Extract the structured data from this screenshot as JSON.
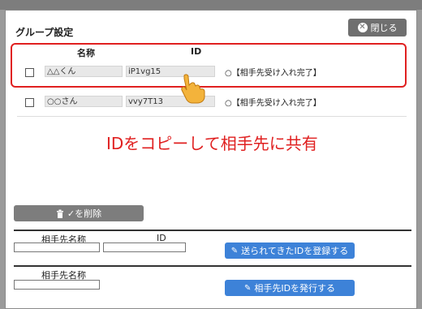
{
  "background": {
    "label1": "",
    "label2": ""
  },
  "dialog": {
    "title": "グループ設定",
    "close_label": "閉じる"
  },
  "table": {
    "headers": {
      "name": "名称",
      "id": "ID"
    },
    "rows": [
      {
        "name": "△△くん",
        "id": "iP1vg15",
        "status": "○【相手先受け入れ完了】"
      },
      {
        "name": "○○さん",
        "id": "vvy7T13",
        "status": "○【相手先受け入れ完了】"
      }
    ]
  },
  "annotation": {
    "caption": "IDをコピーして相手先に共有"
  },
  "delete_label": "✓を削除",
  "register": {
    "partner_name_label": "相手先名称",
    "id_label": "ID",
    "button_label": "送られてきたIDを登録する"
  },
  "issue": {
    "partner_name_label": "相手先名称",
    "button_label": "相手先IDを発行する"
  },
  "colors": {
    "highlight": "#e02020",
    "primary": "#3d82d8",
    "neutral_button": "#6f6f6f"
  },
  "icons": {
    "close": "close-circle-icon",
    "delete": "trash-icon",
    "edit": "pencil-icon",
    "pointer": "hand-pointer-icon"
  }
}
